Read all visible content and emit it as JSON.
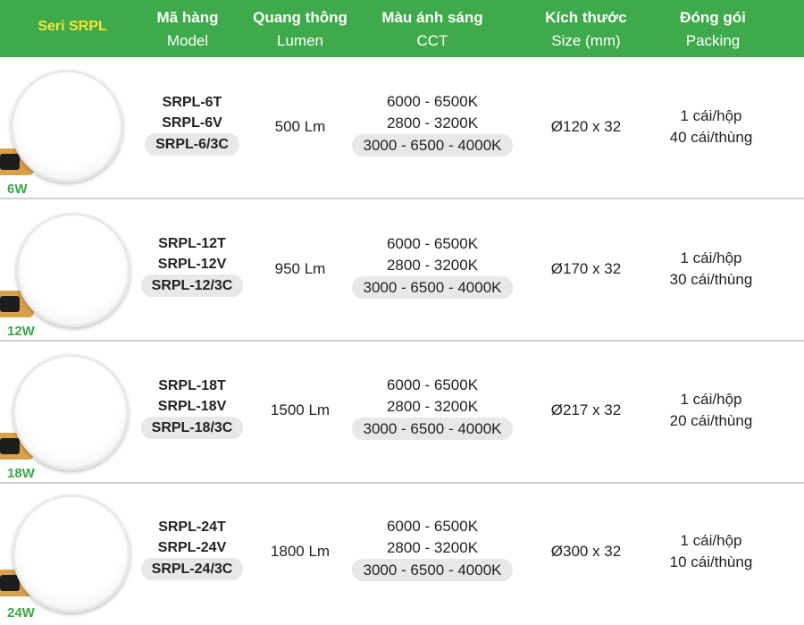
{
  "header": {
    "series": "Seri SRPL",
    "columns": [
      {
        "vi": "Mã hàng",
        "en": "Model"
      },
      {
        "vi": "Quang thông",
        "en": "Lumen"
      },
      {
        "vi": "Màu ánh sáng",
        "en": "CCT"
      },
      {
        "vi": "Kích thước",
        "en": "Size (mm)"
      },
      {
        "vi": "Đóng gói",
        "en": "Packing"
      }
    ]
  },
  "colors": {
    "header_bg": "#3faa4c",
    "series_text": "#f4e53b",
    "watt_text": "#3aa64a"
  },
  "rows": [
    {
      "watt": "6W",
      "models": [
        "SRPL-6T",
        "SRPL-6V",
        "SRPL-6/3C"
      ],
      "lumen": "500 Lm",
      "cct": [
        "6000 - 6500K",
        "2800 - 3200K",
        "3000 - 6500 - 4000K"
      ],
      "size": "Ø120 x 32",
      "packing": [
        "1 cái/hộp",
        "40 cái/thùng"
      ]
    },
    {
      "watt": "12W",
      "models": [
        "SRPL-12T",
        "SRPL-12V",
        "SRPL-12/3C"
      ],
      "lumen": "950 Lm",
      "cct": [
        "6000 - 6500K",
        "2800 - 3200K",
        "3000 - 6500 - 4000K"
      ],
      "size": "Ø170 x 32",
      "packing": [
        "1 cái/hộp",
        "30 cái/thùng"
      ]
    },
    {
      "watt": "18W",
      "models": [
        "SRPL-18T",
        "SRPL-18V",
        "SRPL-18/3C"
      ],
      "lumen": "1500 Lm",
      "cct": [
        "6000 - 6500K",
        "2800 - 3200K",
        "3000 - 6500 - 4000K"
      ],
      "size": "Ø217 x 32",
      "packing": [
        "1 cái/hộp",
        "20 cái/thùng"
      ]
    },
    {
      "watt": "24W",
      "models": [
        "SRPL-24T",
        "SRPL-24V",
        "SRPL-24/3C"
      ],
      "lumen": "1800 Lm",
      "cct": [
        "6000 - 6500K",
        "2800 - 3200K",
        "3000 - 6500 - 4000K"
      ],
      "size": "Ø300 x 32",
      "packing": [
        "1 cái/hộp",
        "10 cái/thùng"
      ]
    }
  ]
}
